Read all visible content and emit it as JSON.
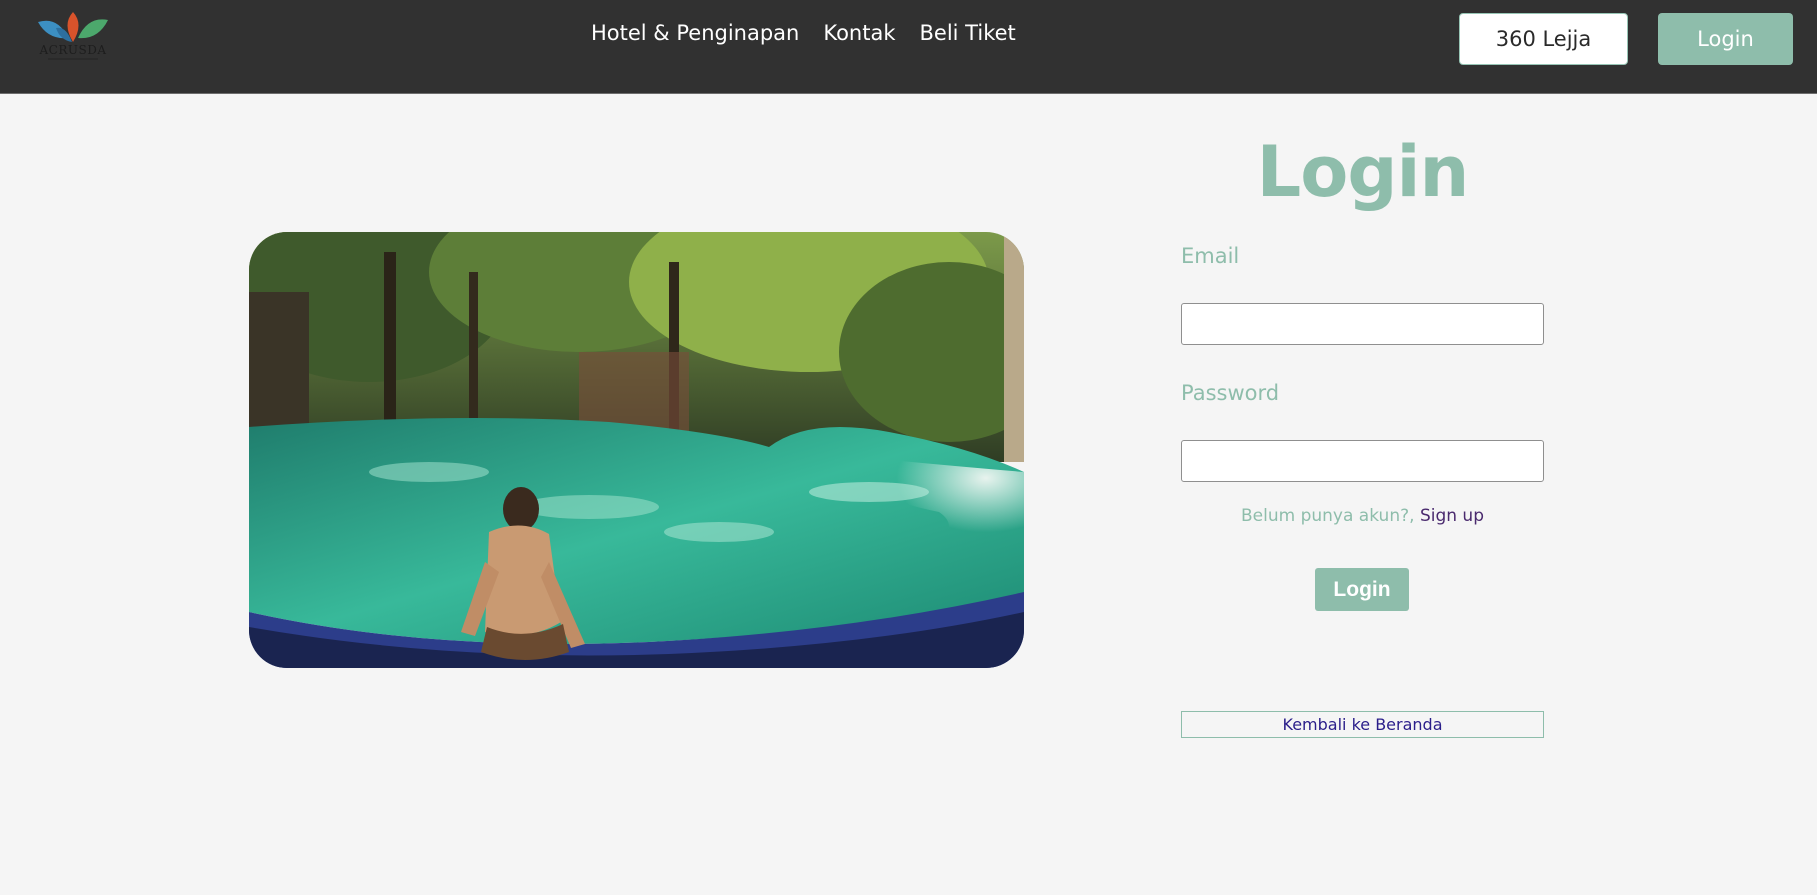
{
  "brand": {
    "logo_text": "ACRUSDA"
  },
  "nav": {
    "items": [
      {
        "label": "Hotel & Penginapan"
      },
      {
        "label": "Kontak"
      },
      {
        "label": "Beli Tiket"
      }
    ]
  },
  "header": {
    "tour_button": "360 Lejja",
    "login_button": "Login"
  },
  "form": {
    "title": "Login",
    "email_label": "Email",
    "email_value": "",
    "password_label": "Password",
    "password_value": "",
    "signup_prompt": "Belum punya akun?,",
    "signup_link": "Sign up",
    "submit_label": "Login",
    "back_label": "Kembali ke Beranda"
  },
  "colors": {
    "header_bg": "#313131",
    "accent": "#8ebdab",
    "page_bg": "#f5f5f5",
    "link": "#4a2a6e"
  }
}
